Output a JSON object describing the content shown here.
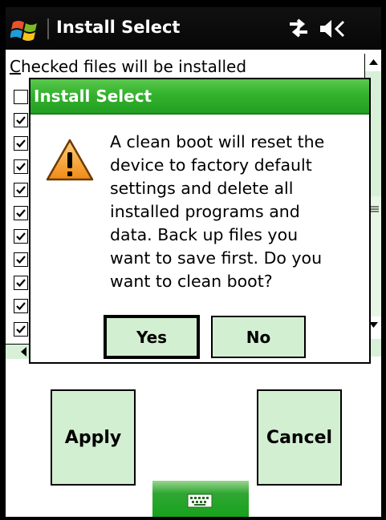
{
  "titlebar": {
    "title": "Install Select",
    "icons": [
      "windows-start-icon",
      "connectivity-icon",
      "volume-muted-icon"
    ]
  },
  "list": {
    "header_accel": "C",
    "header_rest": "hecked files will be installed",
    "items_checked": [
      false,
      true,
      true,
      true,
      true,
      true,
      true,
      true,
      true,
      true,
      true
    ]
  },
  "buttons": {
    "apply": "Apply",
    "cancel": "Cancel"
  },
  "sip": {
    "icon": "keyboard-icon"
  },
  "dialog": {
    "title": "Install Select",
    "icon": "warning-icon",
    "message": "A clean boot will reset the\ndevice to factory default\nsettings and delete all\ninstalled programs and\ndata.  Back up files you\nwant to save first.  Do you\nwant to clean boot?",
    "yes": "Yes",
    "no": "No"
  },
  "colors": {
    "accent_green": "#33b22d",
    "button_fill": "#d3efd1",
    "titlebar_bg": "#0a0a0a"
  }
}
